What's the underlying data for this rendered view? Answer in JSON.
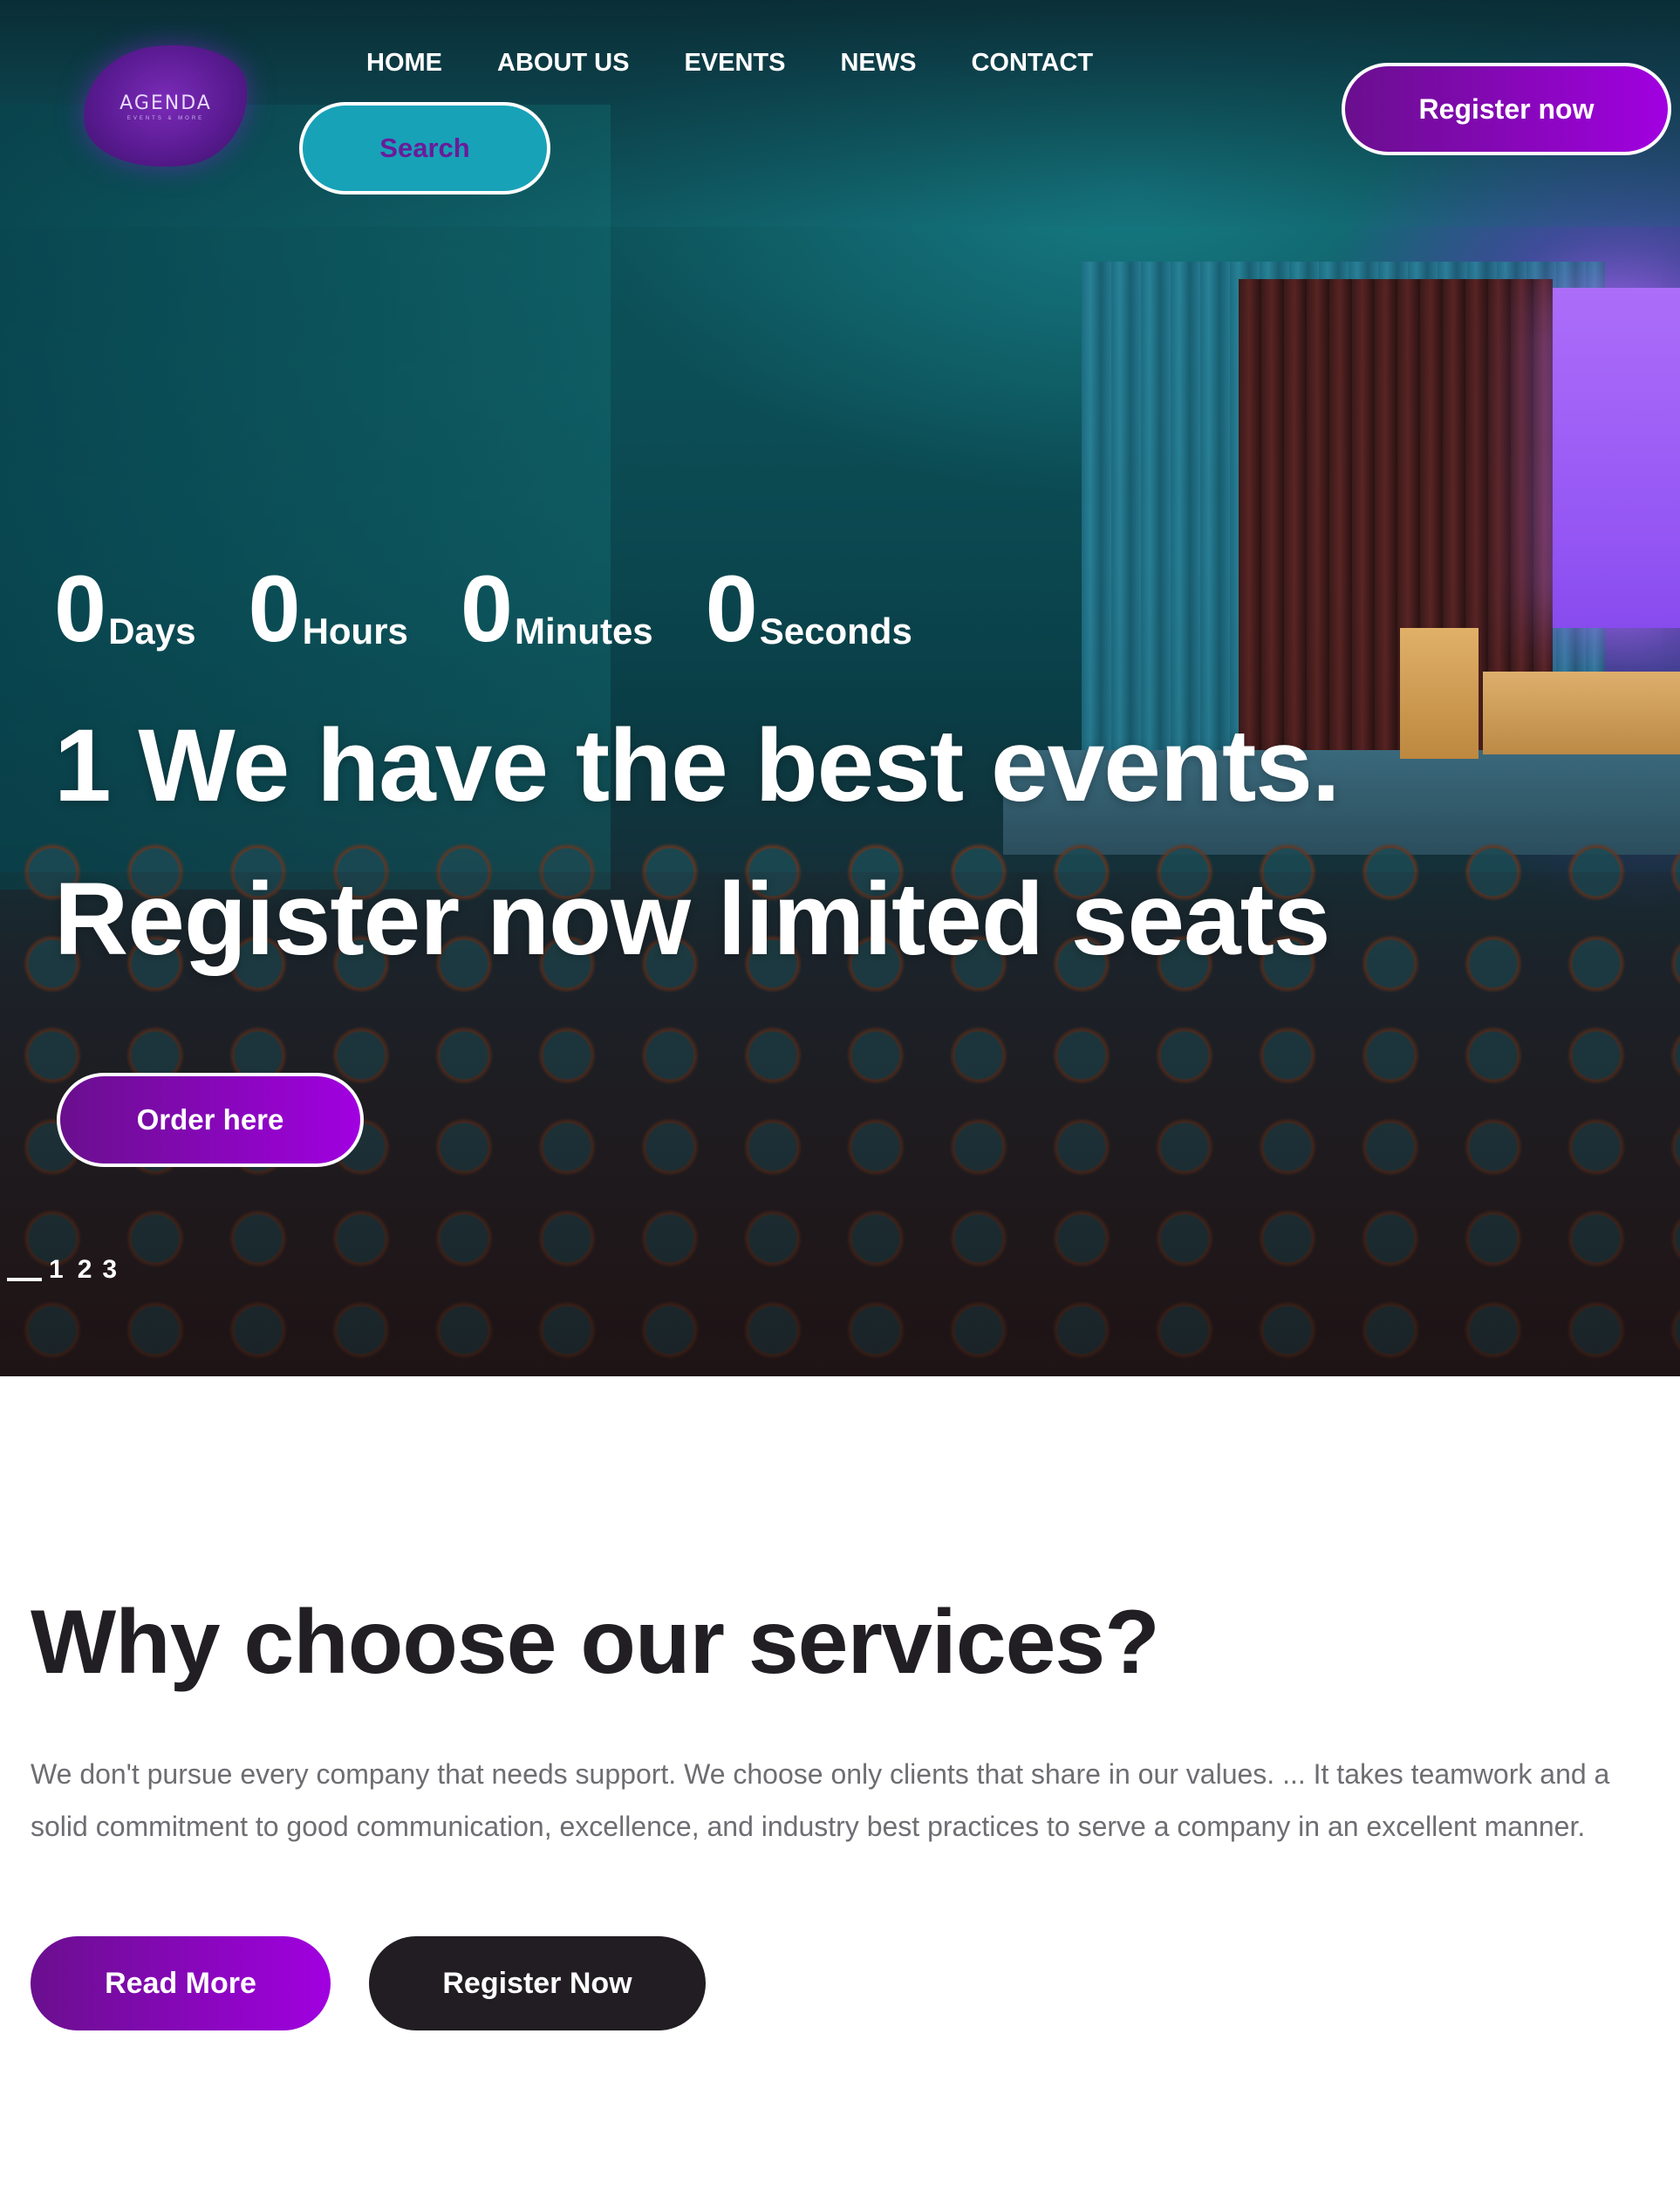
{
  "brand": {
    "logo_text": "AGENDA",
    "logo_subtext": "EVENTS & MORE"
  },
  "nav": {
    "items": [
      {
        "label": "HOME"
      },
      {
        "label": "ABOUT US"
      },
      {
        "label": "EVENTS"
      },
      {
        "label": "NEWS"
      },
      {
        "label": "CONTACT"
      }
    ]
  },
  "header": {
    "search_label": "Search",
    "register_label": "Register now"
  },
  "hero": {
    "countdown": [
      {
        "value": "0",
        "unit": "Days"
      },
      {
        "value": "0",
        "unit": "Hours"
      },
      {
        "value": "0",
        "unit": "Minutes"
      },
      {
        "value": "0",
        "unit": "Seconds"
      }
    ],
    "title_line1": "1 We have the best events.",
    "title_line2": "Register now limited seats",
    "order_label": "Order here",
    "slides": [
      "1",
      "2",
      "3"
    ],
    "active_slide": 1
  },
  "why": {
    "title": "Why choose our services?",
    "text": "We don't pursue every company that needs support. We choose only clients that share in our values. ... It takes teamwork and a solid commitment to good communication, excellence, and industry best practices to serve a company in an excellent manner.",
    "read_more_label": "Read More",
    "register_label": "Register Now"
  },
  "colors": {
    "accent_purple": "#a100e0",
    "accent_purple_dark": "#6a0f8e",
    "search_teal": "#17a2b8",
    "dark_button": "#211d22",
    "heading": "#211f24",
    "body_text": "#6d6d72"
  }
}
